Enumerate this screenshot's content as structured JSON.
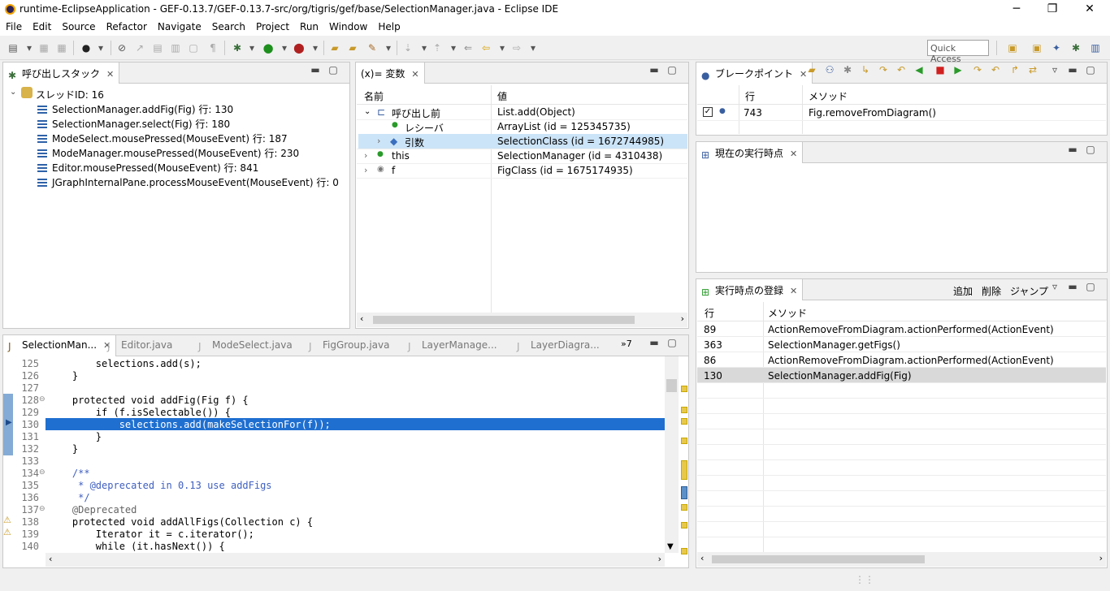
{
  "window": {
    "title": "runtime-EclipseApplication - GEF-0.13.7/GEF-0.13.7-src/org/tigris/gef/base/SelectionManager.java - Eclipse IDE",
    "minimize": "─",
    "restore": "❐",
    "close": "✕"
  },
  "menu": [
    "File",
    "Edit",
    "Source",
    "Refactor",
    "Navigate",
    "Search",
    "Project",
    "Run",
    "Window",
    "Help"
  ],
  "toolbar": {
    "quick_access": "Quick Access"
  },
  "callstack": {
    "tab": "呼び出しスタック",
    "thread": "スレッドID: 16",
    "frames": [
      "SelectionManager.addFig(Fig) 行: 130",
      "SelectionManager.select(Fig) 行: 180",
      "ModeSelect.mousePressed(MouseEvent) 行: 187",
      "ModeManager.mousePressed(MouseEvent) 行: 230",
      "Editor.mousePressed(MouseEvent) 行: 841",
      "JGraphInternalPane.processMouseEvent(MouseEvent) 行: 0"
    ]
  },
  "variables": {
    "tab": "(x)= 変数",
    "col_name": "名前",
    "col_value": "値",
    "rows": [
      {
        "name": "呼び出し前",
        "value": "List.add(Object)"
      },
      {
        "name": "レシーバ",
        "value": "ArrayList (id = 125345735)"
      },
      {
        "name": "引数",
        "value": "SelectionClass (id = 1672744985)"
      },
      {
        "name": "this",
        "value": "SelectionManager (id = 4310438)"
      },
      {
        "name": "f",
        "value": "FigClass (id = 1675174935)"
      }
    ]
  },
  "breakpoints": {
    "tab": "ブレークポイント",
    "col_line": "行",
    "col_method": "メソッド",
    "rows": [
      {
        "line": "743",
        "method": "Fig.removeFromDiagram()"
      }
    ]
  },
  "current_point": {
    "tab": "現在の実行時点"
  },
  "registry": {
    "tab": "実行時点の登録",
    "add": "追加",
    "remove": "削除",
    "jump": "ジャンプ",
    "col_line": "行",
    "col_method": "メソッド",
    "rows": [
      {
        "line": "89",
        "method": "ActionRemoveFromDiagram.actionPerformed(ActionEvent)"
      },
      {
        "line": "363",
        "method": "SelectionManager.getFigs()"
      },
      {
        "line": "86",
        "method": "ActionRemoveFromDiagram.actionPerformed(ActionEvent)"
      },
      {
        "line": "130",
        "method": "SelectionManager.addFig(Fig)"
      }
    ]
  },
  "editor": {
    "tabs": [
      "SelectionMan...",
      "Editor.java",
      "ModeSelect.java",
      "FigGroup.java",
      "LayerManage...",
      "LayerDiagra..."
    ],
    "overflow": "»7",
    "line_numbers": [
      "125",
      "126",
      "127",
      "128",
      "129",
      "130",
      "131",
      "132",
      "133",
      "134",
      "135",
      "136",
      "137",
      "138",
      "139",
      "140"
    ],
    "lines": [
      "        selections.add(s);",
      "    }",
      "",
      "    protected void addFig(Fig f) {",
      "        if (f.isSelectable()) {",
      "            selections.add(makeSelectionFor(f));",
      "        }",
      "    }",
      "",
      "    /**",
      "     * @deprecated in 0.13 use addFigs",
      "     */",
      "    @Deprecated",
      "    protected void addAllFigs(Collection c) {",
      "        Iterator it = c.iterator();",
      "        while (it.hasNext()) {"
    ]
  }
}
